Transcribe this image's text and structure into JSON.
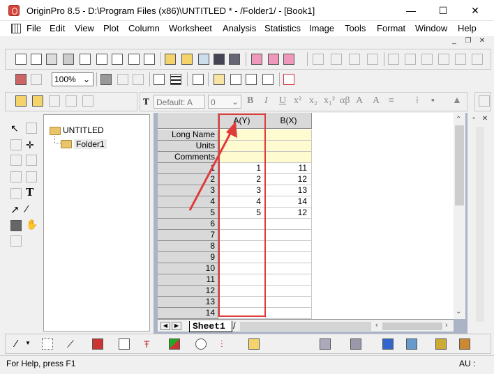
{
  "window": {
    "title": "OriginPro 8.5 - D:\\Program Files (x86)\\UNTITLED * - /Folder1/ - [Book1]",
    "minimize": "—",
    "maximize": "☐",
    "close": "✕"
  },
  "menu": [
    "File",
    "Edit",
    "View",
    "Plot",
    "Column",
    "Worksheet",
    "Analysis",
    "Statistics",
    "Image",
    "Tools",
    "Format",
    "Window",
    "Help"
  ],
  "toolbar": {
    "zoom_value": "100%",
    "font_value": "Default: A",
    "size_value": "0",
    "bold": "B",
    "italic": "I",
    "underline": "U"
  },
  "explorer": {
    "root": "UNTITLED",
    "child": "Folder1"
  },
  "worksheet": {
    "columns": [
      "A(Y)",
      "B(X)"
    ],
    "meta_rows": [
      "Long Name",
      "Units",
      "Comments"
    ],
    "row_numbers": [
      "1",
      "2",
      "3",
      "4",
      "5",
      "6",
      "7",
      "8",
      "9",
      "10",
      "11",
      "12",
      "13",
      "14"
    ],
    "A": [
      "1",
      "2",
      "3",
      "4",
      "5",
      "",
      "",
      "",
      "",
      "",
      "",
      "",
      "",
      ""
    ],
    "B": [
      "11",
      "12",
      "13",
      "14",
      "12",
      "",
      "",
      "",
      "",
      "",
      "",
      "",
      "",
      ""
    ],
    "sheet_tab": "Sheet1"
  },
  "statusbar": {
    "help": "For Help, press F1",
    "right": "AU :"
  },
  "colors": {
    "highlight": "#e03b3b",
    "meta_fill": "#fffbd0",
    "mdi_bg": "#aab4c4"
  }
}
